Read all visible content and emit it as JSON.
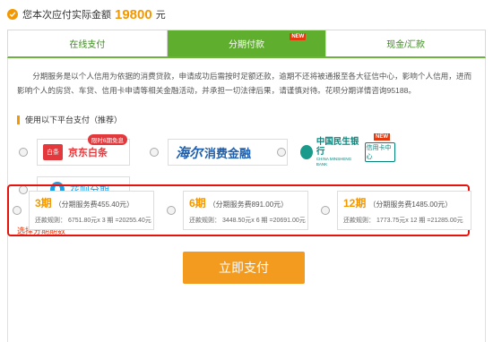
{
  "header": {
    "label": "您本次应付实际金额",
    "amount": "19800",
    "unit": "元"
  },
  "tabs": [
    {
      "label": "在线支付",
      "active": false
    },
    {
      "label": "分期付款",
      "active": true,
      "badge": "NEW"
    },
    {
      "label": "现金/汇款",
      "active": false
    }
  ],
  "description": "分期服务是以个人信用为依据的消费贷款，申请成功后需按时足额还款，逾期不还将被通报至各大征信中心，影响个人信用，进而影响个人的房贷、车贷、信用卡申请等相关金融活动，并承担一切法律后果，请谨慎对待。花呗分期详情咨询95188。",
  "platforms_section": {
    "title": "使用以下平台支付（推荐）"
  },
  "platforms": [
    {
      "name": "京东白条",
      "mark": "白条",
      "badge": "限时6期免息"
    },
    {
      "name": "消费金融",
      "script": "海尔"
    },
    {
      "name": "中国民生银行",
      "en": "CHINA MINSHENG BANK",
      "card": "信用卡中心",
      "badge": "NEW"
    },
    {
      "name": "花呗分期"
    }
  ],
  "installment_section": {
    "title": "选择分期期数"
  },
  "installments": [
    {
      "period": "3期",
      "fee": "（分期服务费455.40元）",
      "rule": "还款规则：  6751.80元x 3 期 =20255.40元"
    },
    {
      "period": "6期",
      "fee": "（分期服务费891.00元）",
      "rule": "还款规则：  3448.50元x 6 期 =20691.00元"
    },
    {
      "period": "12期",
      "fee": "（分期服务费1485.00元）",
      "rule": "还款规则：  1773.75元x 12 期 =21285.00元"
    }
  ],
  "pay_button": {
    "label": "立即支付"
  },
  "colors": {
    "accent_orange": "#f39800",
    "tab_green": "#5fae2d",
    "highlight_red": "#e8120c",
    "pay_button": "#f39b1e"
  },
  "icons": [
    "check-circle-icon",
    "radio-icon"
  ]
}
